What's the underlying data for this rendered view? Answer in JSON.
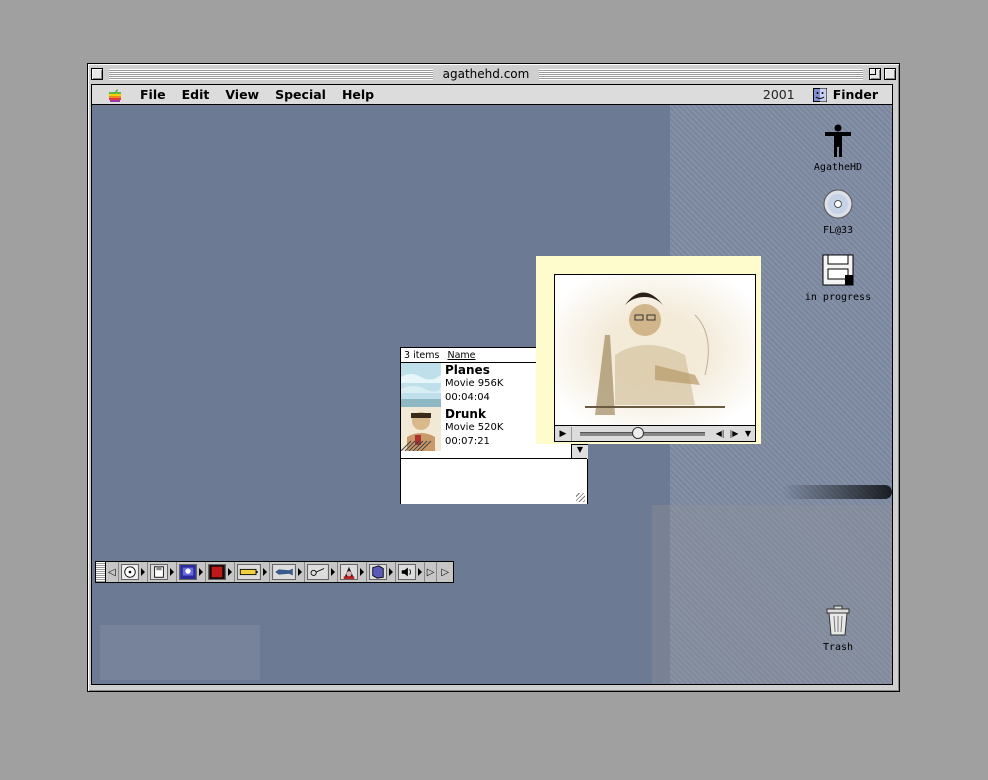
{
  "window": {
    "title": "agathehd.com"
  },
  "menubar": {
    "items": [
      {
        "label": "File"
      },
      {
        "label": "Edit"
      },
      {
        "label": "View"
      },
      {
        "label": "Special"
      },
      {
        "label": "Help"
      }
    ],
    "clock": "2001",
    "app_name": "Finder"
  },
  "desktop_icons": [
    {
      "label": "AgatheHD",
      "icon": "person-silhouette-icon"
    },
    {
      "label": "FL@33",
      "icon": "cd-icon"
    },
    {
      "label": "in progress",
      "icon": "zip-disk-icon"
    },
    {
      "label": "Trash",
      "icon": "trash-icon"
    }
  ],
  "list_window": {
    "item_count": "3 items",
    "column_name": "Name",
    "items": [
      {
        "title": "Planes",
        "kind": "Movie 956K",
        "duration": "00:04:04"
      },
      {
        "title": "Drunk",
        "kind": "Movie 520K",
        "duration": "00:07:21"
      }
    ]
  },
  "movie_player": {
    "progress": 0.46
  },
  "control_strip": {
    "modules": [
      "cd-icon",
      "floppy-icon",
      "monitor-icon",
      "red-square-icon",
      "battery-icon",
      "fish-icon",
      "key-icon",
      "face-icon",
      "book-icon",
      "speaker-icon"
    ]
  },
  "colors": {
    "desktop": "#6c7a93",
    "movie_window": "#fefccc"
  }
}
